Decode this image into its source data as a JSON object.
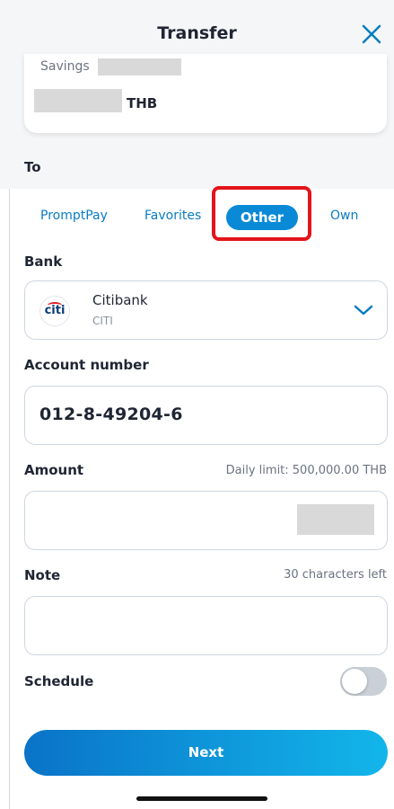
{
  "header": {
    "title": "Transfer",
    "close_icon": "close-icon"
  },
  "source_account": {
    "type_label": "Savings",
    "currency": "THB"
  },
  "to_label": "To",
  "tabs": [
    {
      "label": "PromptPay",
      "selected": false
    },
    {
      "label": "Favorites",
      "selected": false
    },
    {
      "label": "Other",
      "selected": true
    },
    {
      "label": "Own",
      "selected": false
    }
  ],
  "form": {
    "bank_label": "Bank",
    "bank": {
      "name": "Citibank",
      "code": "CITI",
      "logo_text": "citi"
    },
    "account_label": "Account number",
    "account_value": "012-8-49204-6",
    "amount_label": "Amount",
    "amount_hint": "Daily limit: 500,000.00 THB",
    "note_label": "Note",
    "note_hint": "30 characters left",
    "schedule_label": "Schedule",
    "schedule_on": false
  },
  "next_button": "Next",
  "colors": {
    "accent": "#0a8ad6",
    "highlight": "#e3141b",
    "text": "#1f2533"
  }
}
